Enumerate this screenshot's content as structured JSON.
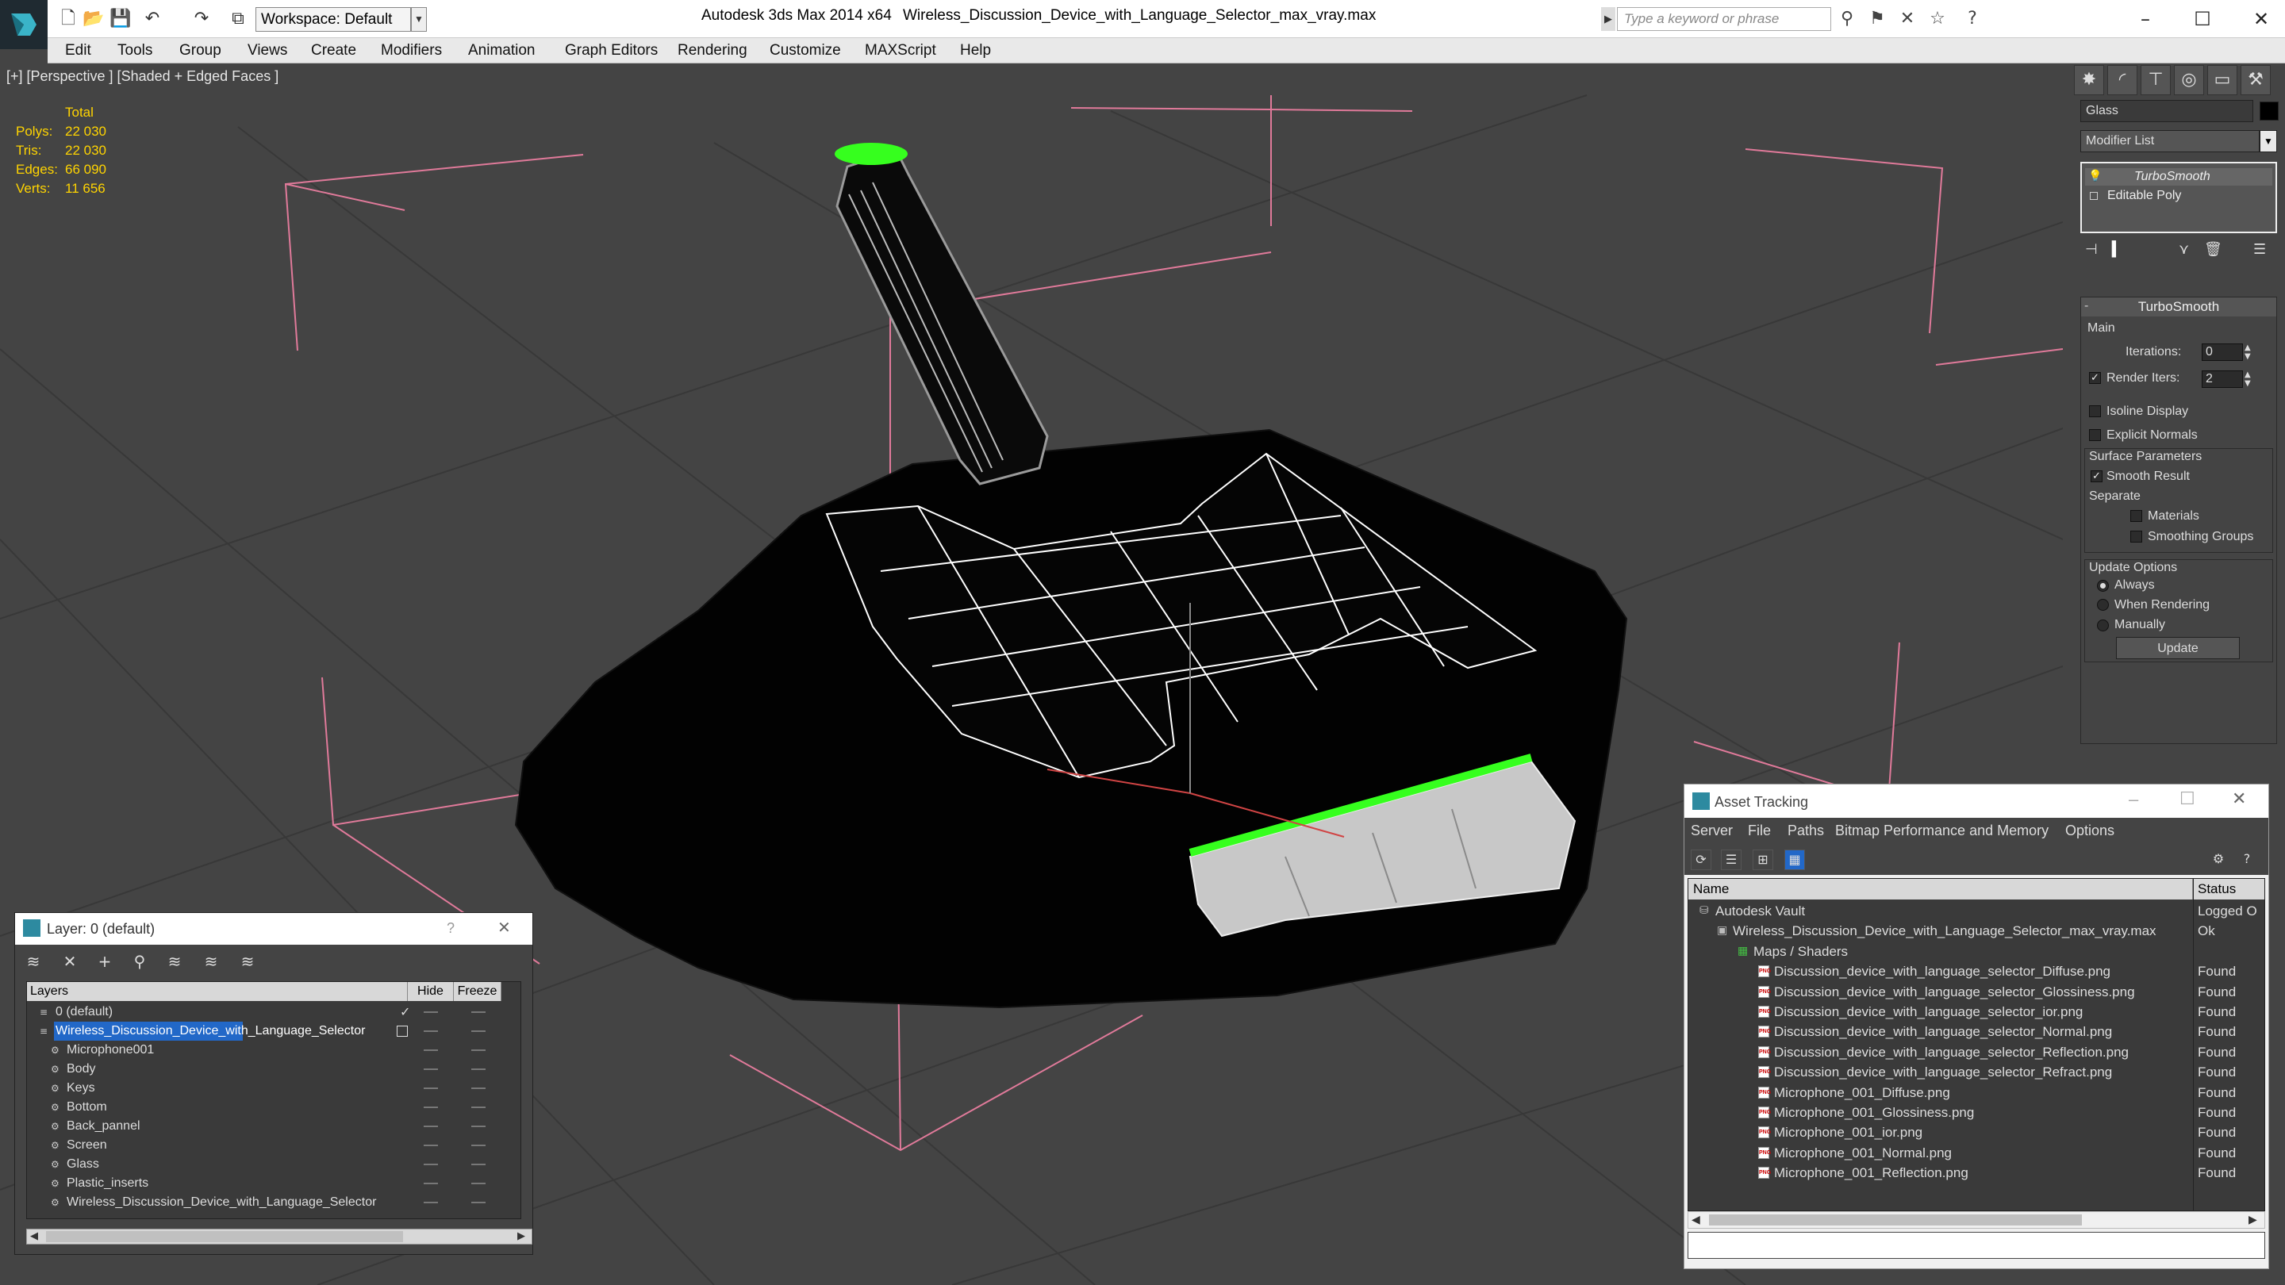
{
  "titlebar": {
    "app_title": "Autodesk 3ds Max  2014 x64",
    "file_title": "Wireless_Discussion_Device_with_Language_Selector_max_vray.max",
    "workspace": "Workspace: Default",
    "search_placeholder": "Type a keyword or phrase"
  },
  "menubar": [
    "Edit",
    "Tools",
    "Group",
    "Views",
    "Create",
    "Modifiers",
    "Animation",
    "Graph Editors",
    "Rendering",
    "Customize",
    "MAXScript",
    "Help"
  ],
  "viewport": {
    "label": "[+] [Perspective ] [Shaded + Edged Faces ]",
    "stats": {
      "header": "Total",
      "rows": [
        {
          "label": "Polys:",
          "value": "22 030"
        },
        {
          "label": "Tris:",
          "value": "22 030"
        },
        {
          "label": "Edges:",
          "value": "66 090"
        },
        {
          "label": "Verts:",
          "value": "11 656"
        }
      ]
    }
  },
  "command_panel": {
    "object_name": "Glass",
    "modifier_list": "Modifier List",
    "stack": [
      "TurboSmooth",
      "Editable Poly"
    ],
    "rollout_title": "TurboSmooth",
    "main_label": "Main",
    "iterations_label": "Iterations:",
    "iterations_value": "0",
    "render_iters_label": "Render Iters:",
    "render_iters_value": "2",
    "isoline_label": "Isoline Display",
    "explicit_normals_label": "Explicit Normals",
    "surface_params_label": "Surface Parameters",
    "smooth_result_label": "Smooth Result",
    "separate_label": "Separate",
    "materials_label": "Materials",
    "smoothing_groups_label": "Smoothing Groups",
    "update_options_label": "Update Options",
    "always_label": "Always",
    "when_rendering_label": "When Rendering",
    "manually_label": "Manually",
    "update_button": "Update"
  },
  "layer_panel": {
    "title": "Layer: 0 (default)",
    "help": "?",
    "columns": [
      "Layers",
      "Hide",
      "Freeze"
    ],
    "rows": [
      {
        "name": "0 (default)",
        "level": 0
      },
      {
        "name": "Wireless_Discussion_Device_with_Language_Selector",
        "level": 0,
        "selected": true
      },
      {
        "name": "Microphone001",
        "level": 1
      },
      {
        "name": "Body",
        "level": 1
      },
      {
        "name": "Keys",
        "level": 1
      },
      {
        "name": "Bottom",
        "level": 1
      },
      {
        "name": "Back_pannel",
        "level": 1
      },
      {
        "name": "Screen",
        "level": 1
      },
      {
        "name": "Glass",
        "level": 1
      },
      {
        "name": "Plastic_inserts",
        "level": 1
      },
      {
        "name": "Wireless_Discussion_Device_with_Language_Selector",
        "level": 1
      }
    ]
  },
  "asset_panel": {
    "title": "Asset Tracking",
    "menu": [
      "Server",
      "File",
      "Paths",
      "Bitmap Performance and Memory",
      "Options"
    ],
    "columns": [
      "Name",
      "Status"
    ],
    "rows": [
      {
        "name": "Autodesk Vault",
        "status": "Logged O",
        "level": 0
      },
      {
        "name": "Wireless_Discussion_Device_with_Language_Selector_max_vray.max",
        "status": "Ok",
        "level": 1
      },
      {
        "name": "Maps / Shaders",
        "status": "",
        "level": 2
      },
      {
        "name": "Discussion_device_with_language_selector_Diffuse.png",
        "status": "Found",
        "level": 3
      },
      {
        "name": "Discussion_device_with_language_selector_Glossiness.png",
        "status": "Found",
        "level": 3
      },
      {
        "name": "Discussion_device_with_language_selector_ior.png",
        "status": "Found",
        "level": 3
      },
      {
        "name": "Discussion_device_with_language_selector_Normal.png",
        "status": "Found",
        "level": 3
      },
      {
        "name": "Discussion_device_with_language_selector_Reflection.png",
        "status": "Found",
        "level": 3
      },
      {
        "name": "Discussion_device_with_language_selector_Refract.png",
        "status": "Found",
        "level": 3
      },
      {
        "name": "Microphone_001_Diffuse.png",
        "status": "Found",
        "level": 3
      },
      {
        "name": "Microphone_001_Glossiness.png",
        "status": "Found",
        "level": 3
      },
      {
        "name": "Microphone_001_ior.png",
        "status": "Found",
        "level": 3
      },
      {
        "name": "Microphone_001_Normal.png",
        "status": "Found",
        "level": 3
      },
      {
        "name": "Microphone_001_Reflection.png",
        "status": "Found",
        "level": 3
      }
    ]
  },
  "colors": {
    "viewport_bg": "#444444",
    "stats_yellow": "#ffd400",
    "selection_blue": "#2268c8",
    "gizmo_pink": "#e07a9a",
    "highlight_green": "#36ff1e"
  }
}
